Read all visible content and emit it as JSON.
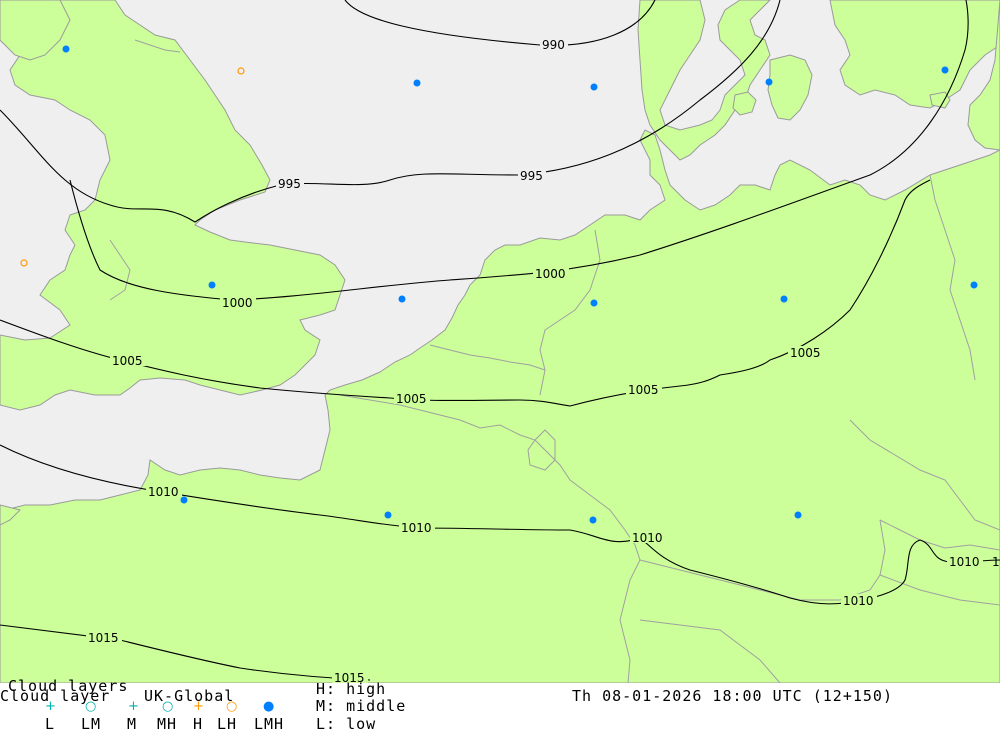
{
  "legend": {
    "title_top": "Cloud layers",
    "title": "Cloud layer",
    "model": "UK-Global",
    "codes": [
      "L",
      "LM",
      "M",
      "MH",
      "H",
      "LH",
      "LMH"
    ],
    "key_high": "H: high",
    "key_middle": "M: middle",
    "key_low": "L: low",
    "datetime": "Th 08-01-2026 18:00 UTC (12+150)"
  },
  "isobars": [
    "990",
    "995",
    "995",
    "1000",
    "1000",
    "1005",
    "1005",
    "1005",
    "1005",
    "1010",
    "1010",
    "1010",
    "1010",
    "1010",
    "1",
    "1015",
    "1015"
  ],
  "colors": {
    "land": "#ccff99",
    "sea": "#efefef",
    "marker_blue": "#0080ff",
    "marker_orange": "#ff9900",
    "marker_cyan": "#00b0b0"
  },
  "marker_types": [
    "LMH",
    "LH"
  ]
}
